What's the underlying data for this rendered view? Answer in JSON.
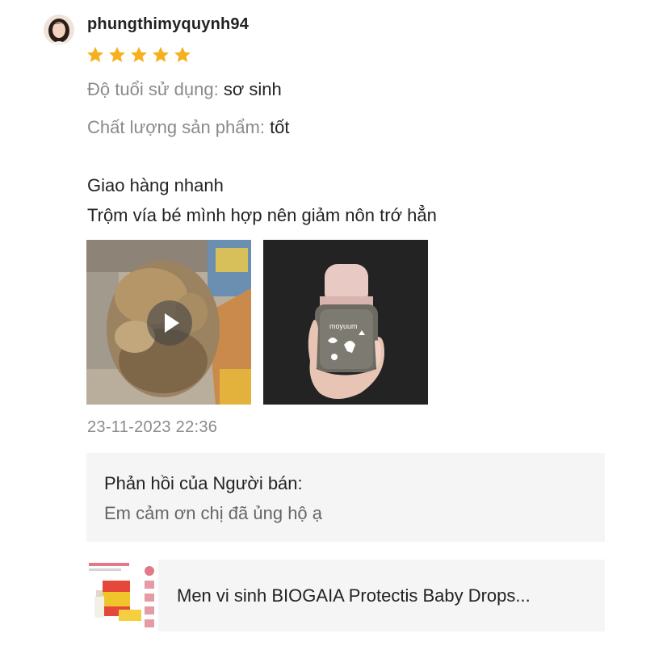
{
  "review": {
    "username": "phungthimyquynh94",
    "rating": 5,
    "star_color": "#f6b01e",
    "attributes": [
      {
        "key": "Độ tuổi sử dụng:",
        "value": "sơ sinh"
      },
      {
        "key": "Chất lượng sản phẩm:",
        "value": "tốt"
      }
    ],
    "comment_lines": [
      "Giao hàng nhanh",
      "Trộm vía bé mình hợp nên giảm nôn trớ hẳn"
    ],
    "media": [
      {
        "kind": "video",
        "icon": "play-icon"
      },
      {
        "kind": "photo",
        "bottle_brand": "moyuum"
      }
    ],
    "timestamp": "23-11-2023 22:36"
  },
  "seller_reply": {
    "title": "Phản hồi của Người bán:",
    "text": "Em cảm ơn chị đã ủng hộ ạ"
  },
  "product": {
    "name": "Men vi sinh BIOGAIA Protectis Baby Drops..."
  }
}
